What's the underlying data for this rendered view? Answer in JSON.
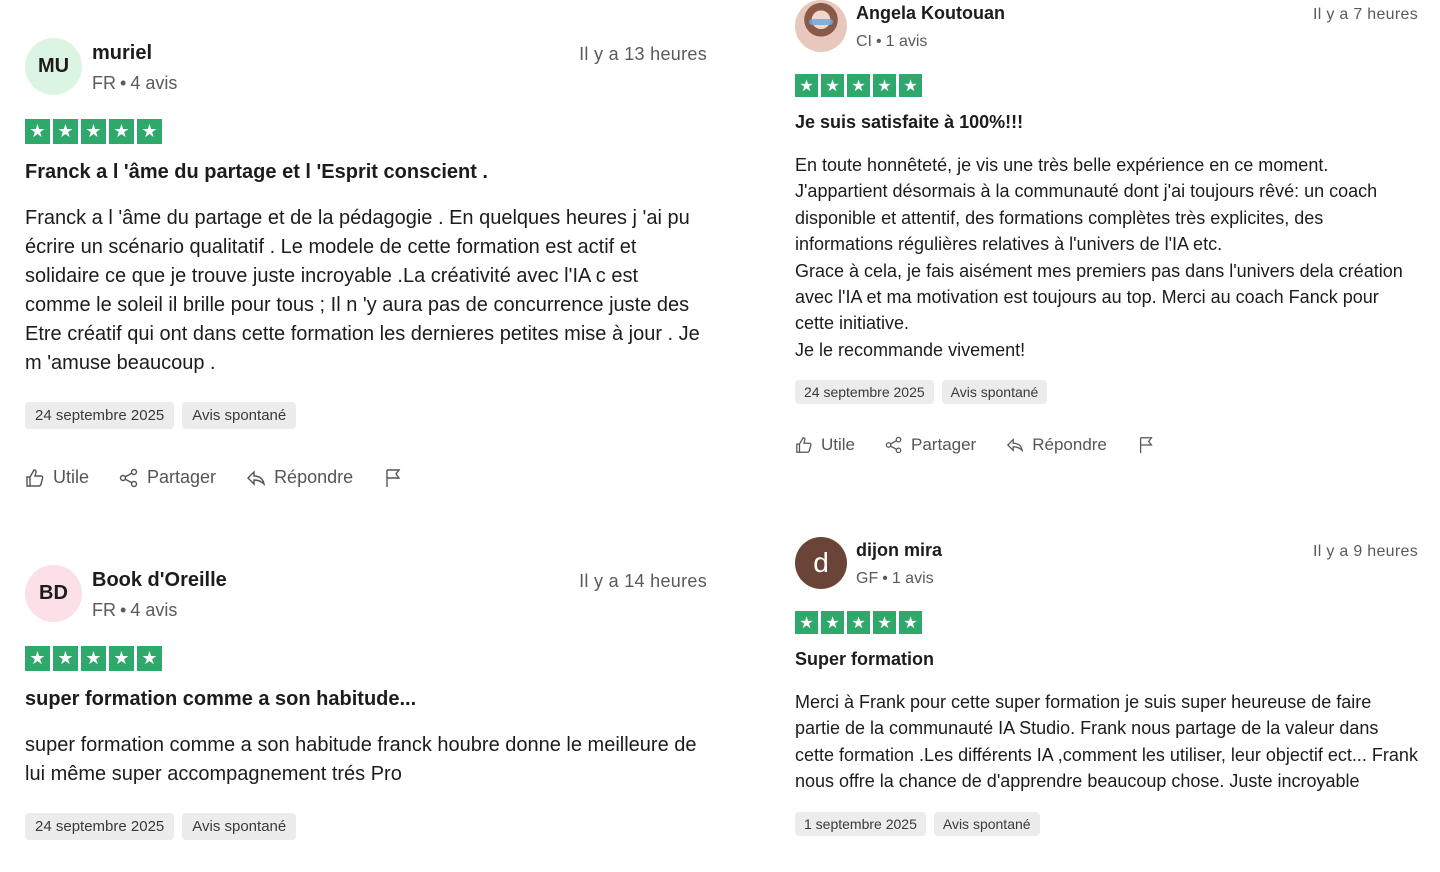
{
  "reviews": [
    {
      "avatar_initials": "MU",
      "name": "muriel",
      "country": "FR",
      "review_count": "4 avis",
      "time": "Il y a 13 heures",
      "rating": 5,
      "title": "Franck a l 'âme du partage et l 'Esprit conscient .",
      "body": "Franck a l 'âme du partage et de la pédagogie . En quelques heures j 'ai pu écrire un scénario qualitatif . Le modele de cette formation est actif et solidaire ce que je trouve juste incroyable .La créativité avec l'IA c est comme le soleil il brille pour tous ; Il n 'y aura pas de concurrence juste des Etre créatif qui ont dans cette formation les dernieres petites mise à jour . Je m 'amuse beaucoup .",
      "date": "24 septembre 2025",
      "tag": "Avis spontané",
      "actions": {
        "useful": "Utile",
        "share": "Partager",
        "reply": "Répondre"
      }
    },
    {
      "avatar_initials": "BD",
      "name": "Book d'Oreille",
      "country": "FR",
      "review_count": "4 avis",
      "time": "Il y a 14 heures",
      "rating": 5,
      "title": "super formation comme a son habitude...",
      "body": "super formation comme a son habitude franck houbre donne le meilleure de lui même super accompagnement trés Pro",
      "date": "24 septembre 2025",
      "tag": "Avis spontané"
    },
    {
      "name": "Angela Koutouan",
      "country": "CI",
      "review_count": "1 avis",
      "time": "Il y a 7 heures",
      "rating": 5,
      "title": "Je suis satisfaite à 100%!!!",
      "body_lines": [
        "En toute honnêteté, je vis une très belle expérience en ce moment. J'appartient désormais à la communauté dont j'ai toujours rêvé: un coach disponible et attentif, des formations complètes très explicites, des informations régulières relatives à l'univers de l'IA etc.",
        "Grace à cela, je fais aisément mes premiers pas dans l'univers dela création avec l'IA et ma motivation est toujours au top. Merci au coach Fanck pour cette initiative.",
        "Je le recommande vivement!"
      ],
      "date": "24 septembre 2025",
      "tag": "Avis spontané",
      "actions": {
        "useful": "Utile",
        "share": "Partager",
        "reply": "Répondre"
      }
    },
    {
      "avatar_initials": "d",
      "name": "dijon mira",
      "country": "GF",
      "review_count": "1 avis",
      "time": "Il y a 9 heures",
      "rating": 5,
      "title": "Super formation",
      "body": "Merci à Frank pour cette super formation je suis super heureuse de faire partie de la communauté IA Studio. Frank nous partage de la valeur dans cette formation .Les différents IA ,comment les utiliser, leur objectif ect... Frank nous offre la chance de d'apprendre beaucoup chose. Juste incroyable",
      "date": "1 septembre 2025",
      "tag": "Avis spontané"
    }
  ],
  "colors": {
    "star_green": "#2fa86c",
    "text": "#1c1c1c",
    "muted": "#5a5a5a",
    "tag_bg": "#ececec"
  },
  "icons": {
    "useful": "thumbs-up-icon",
    "share": "share-icon",
    "reply": "reply-icon",
    "report": "flag-icon"
  }
}
